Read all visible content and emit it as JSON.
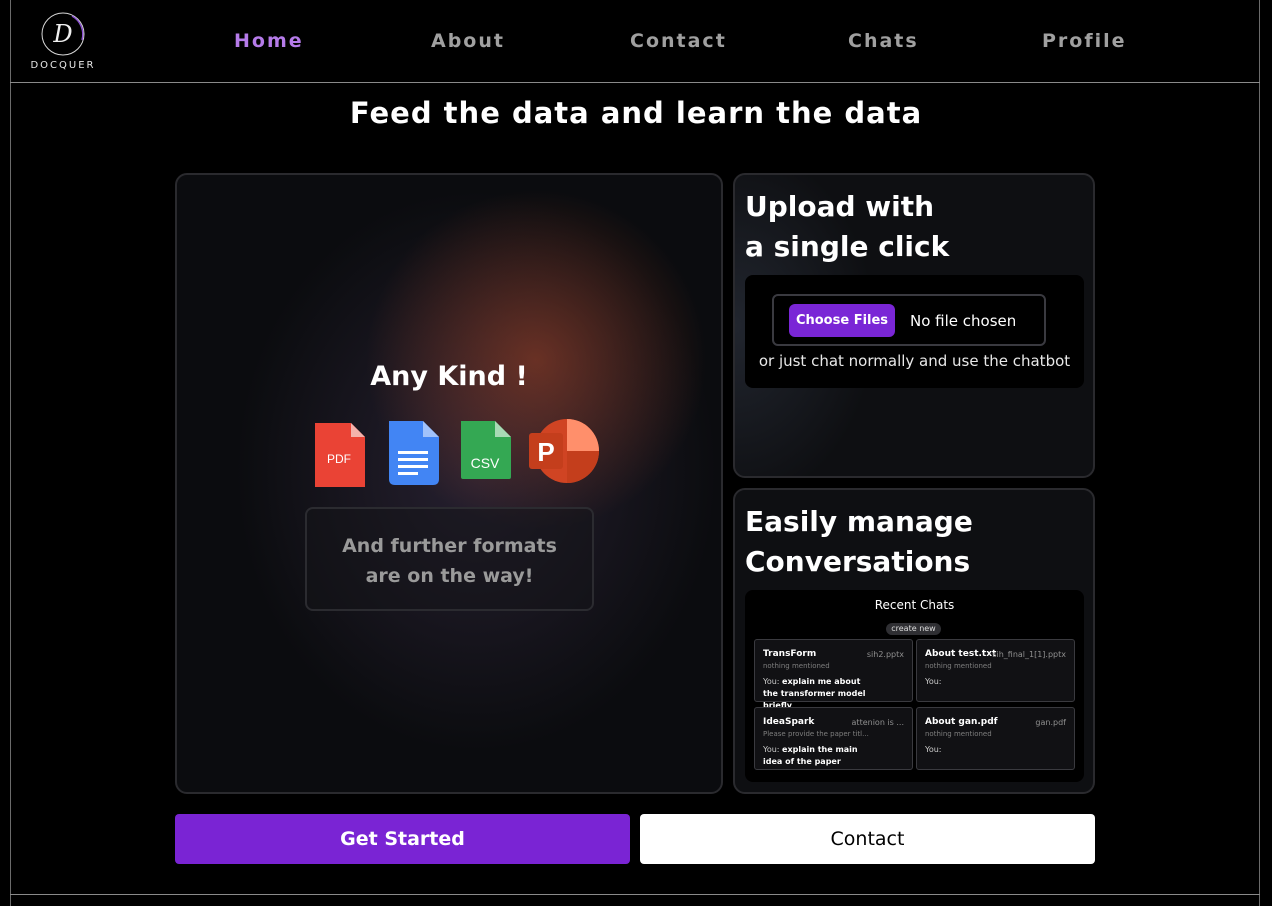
{
  "nav": {
    "logo_text": "DOCQUER",
    "logo_letter": "D",
    "links": [
      {
        "label": "Home",
        "active": true
      },
      {
        "label": "About",
        "active": false
      },
      {
        "label": "Contact",
        "active": false
      },
      {
        "label": "Chats",
        "active": false
      },
      {
        "label": "Profile",
        "active": false
      }
    ],
    "active_color": "#b57be9"
  },
  "headline": "Feed the data and learn the data",
  "formats_card": {
    "title": "Any Kind !",
    "icons": [
      {
        "name": "pdf-file-icon",
        "label": "PDF",
        "color": "#ea4335"
      },
      {
        "name": "docs-file-icon",
        "label": "",
        "color": "#4285f4"
      },
      {
        "name": "csv-file-icon",
        "label": "CSV",
        "color": "#34a853"
      },
      {
        "name": "powerpoint-icon",
        "label": "P",
        "color": "#d04423"
      }
    ],
    "further_line1": "And further formats",
    "further_line2": "are on the way!"
  },
  "upload_card": {
    "title_line1": "Upload with",
    "title_line2": "a single click",
    "choose_files": "Choose Files",
    "no_file": "No file chosen",
    "hint": "or just chat normally and use the chatbot"
  },
  "manage_card": {
    "title_line1": "Easily manage",
    "title_line2": "Conversations",
    "recent_title": "Recent Chats",
    "create_new": "create new",
    "chats": [
      {
        "title": "TransForm",
        "file": "sih2.pptx",
        "sub": "nothing mentioned",
        "you": "You:",
        "msg": "explain me about the transformer model briefly"
      },
      {
        "title": "About test.txt",
        "file": "sih_final_1[1].pptx",
        "sub": "nothing mentioned",
        "you": "You:",
        "msg": ""
      },
      {
        "title": "IdeaSpark",
        "file": "attenion is ...",
        "sub": "Please provide the paper titl...",
        "you": "You:",
        "msg": "explain the main idea of the paper"
      },
      {
        "title": "About gan.pdf",
        "file": "gan.pdf",
        "sub": "nothing mentioned",
        "you": "You:",
        "msg": ""
      }
    ]
  },
  "actions": {
    "get_started": "Get Started",
    "contact": "Contact"
  },
  "colors": {
    "accent": "#7a24d4",
    "background": "#000000"
  }
}
